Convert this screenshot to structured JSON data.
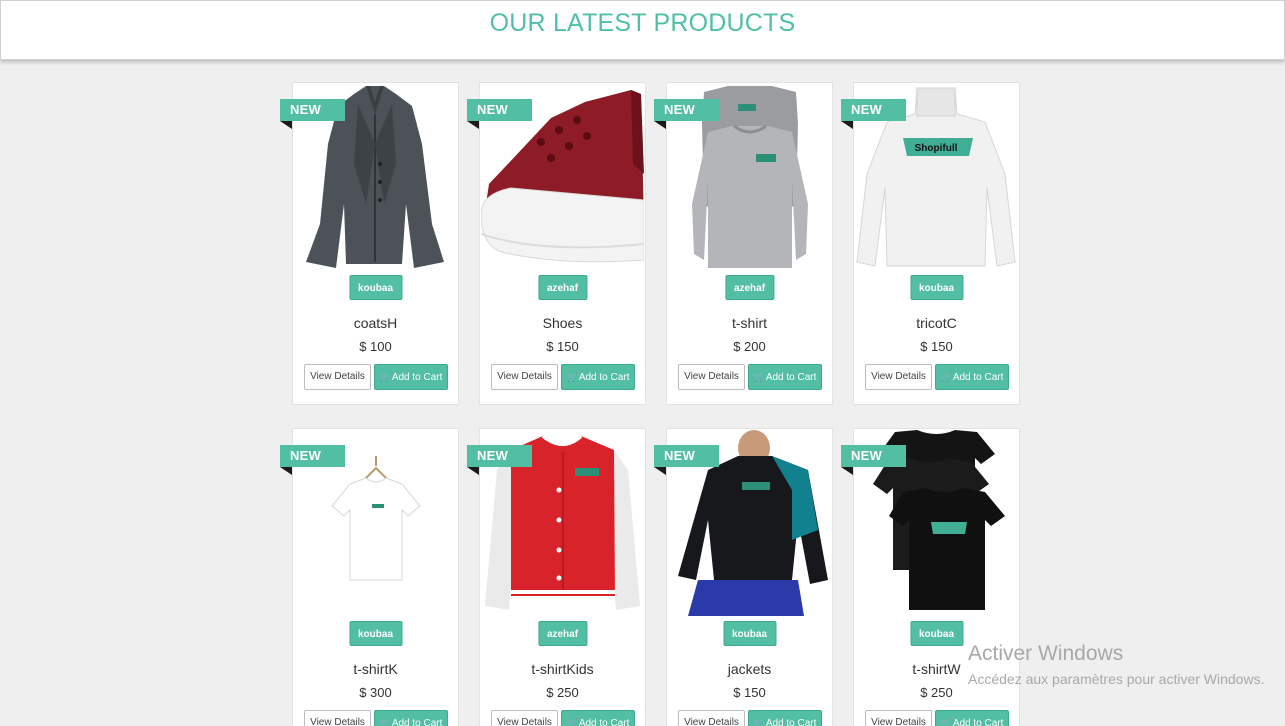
{
  "header": {
    "title": "OUR LATEST PRODUCTS"
  },
  "ribbon_label": "NEW",
  "buttons": {
    "view_label": "View Details",
    "cart_label": "Add to Cart"
  },
  "colors": {
    "accent": "#52bfa5",
    "title": "#4fbfa8",
    "background": "#efefef"
  },
  "products": [
    {
      "name": "coatsH",
      "price": "$ 100",
      "brand": "koubaa",
      "image": "grey-coat"
    },
    {
      "name": "Shoes",
      "price": "$ 150",
      "brand": "azehaf",
      "image": "red-sneaker"
    },
    {
      "name": "t-shirt",
      "price": "$ 200",
      "brand": "azehaf",
      "image": "grey-longsleeve-shirts"
    },
    {
      "name": "tricotC",
      "price": "$ 150",
      "brand": "koubaa",
      "image": "white-turtleneck-sweater"
    },
    {
      "name": "t-shirtK",
      "price": "$ 300",
      "brand": "koubaa",
      "image": "white-kids-tshirt"
    },
    {
      "name": "t-shirtKids",
      "price": "$ 250",
      "brand": "azehaf",
      "image": "red-varsity-jacket"
    },
    {
      "name": "jackets",
      "price": "$ 150",
      "brand": "koubaa",
      "image": "black-teal-jacket"
    },
    {
      "name": "t-shirtW",
      "price": "$ 250",
      "brand": "koubaa",
      "image": "black-tshirts"
    }
  ],
  "watermark": {
    "title": "Activer Windows",
    "subtitle": "Accédez aux paramètres pour activer Windows."
  }
}
